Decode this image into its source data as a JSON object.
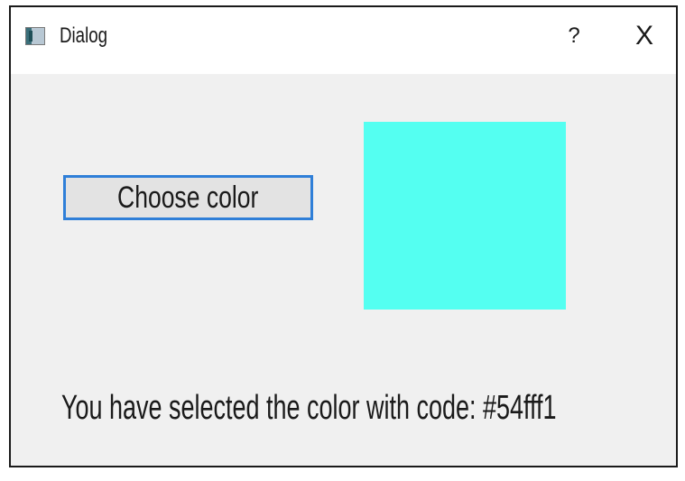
{
  "window": {
    "title": "Dialog",
    "help_label": "?",
    "close_label": "X"
  },
  "main": {
    "choose_button_label": "Choose color",
    "selected_color": "#54fff1",
    "result_text": "You have selected the color with code: #54fff1"
  },
  "colors": {
    "swatch": "#54fff1",
    "button_focus_border": "#2f7fd8",
    "dialog_background": "#f0f0f0"
  },
  "icons": {
    "app": "window-app-icon",
    "help": "help-icon",
    "close": "close-icon"
  }
}
